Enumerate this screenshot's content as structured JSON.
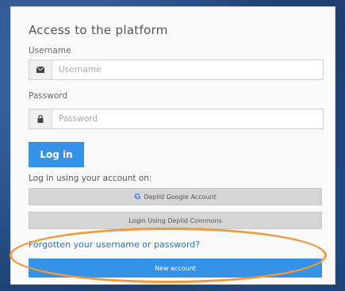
{
  "form": {
    "title": "Access to the platform",
    "username": {
      "label": "Username",
      "placeholder": "Username",
      "icon": "envelope-icon"
    },
    "password": {
      "label": "Password",
      "placeholder": "Password",
      "icon": "lock-icon"
    },
    "login_button": "Log in",
    "alt_login_label": "Log in using your account on:",
    "google_button": "Deplid Google Account",
    "google_icon": "google-g-icon",
    "commons_button": "Login Using Deplid Commons",
    "forgot_link": "Forgotten your username or password?",
    "new_account_button": "New account"
  },
  "colors": {
    "primary": "#3592e6",
    "highlight": "#ef9a3d",
    "background": "#1e3f6e"
  }
}
